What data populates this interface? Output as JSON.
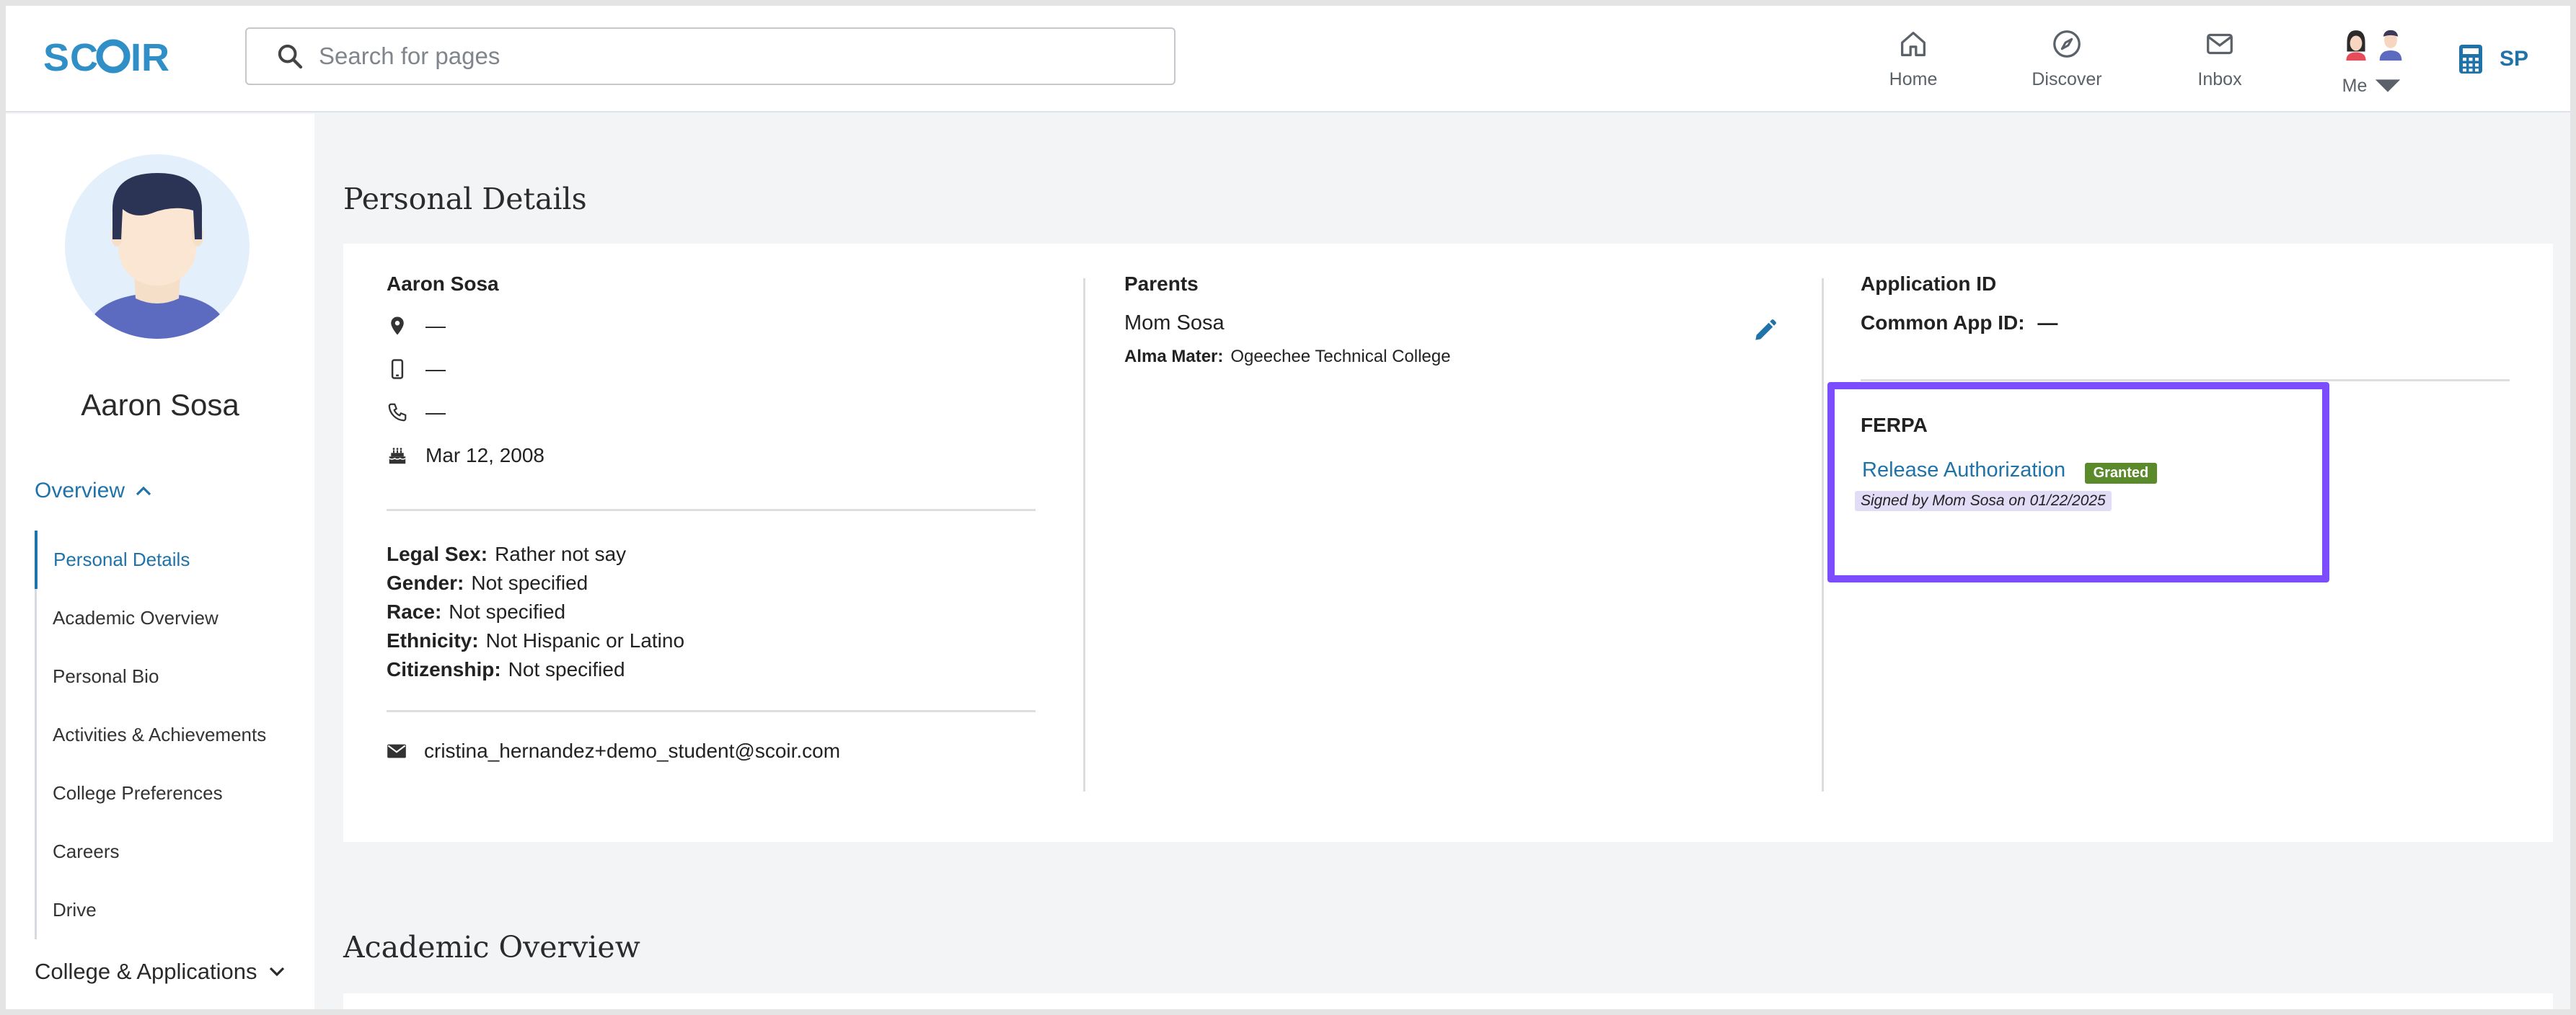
{
  "brand": {
    "logo_text": "SCOIR",
    "accent": "#1f73a8",
    "highlight": "#7c4dff"
  },
  "search": {
    "placeholder": "Search for pages",
    "value": ""
  },
  "nav": {
    "home": "Home",
    "discover": "Discover",
    "inbox": "Inbox",
    "me": "Me",
    "sp": "SP"
  },
  "sidebar": {
    "student_name": "Aaron Sosa",
    "overview": "Overview",
    "items": [
      {
        "label": "Personal Details",
        "active": true
      },
      {
        "label": "Academic Overview"
      },
      {
        "label": "Personal Bio"
      },
      {
        "label": "Activities & Achievements"
      },
      {
        "label": "College Preferences"
      },
      {
        "label": "Careers"
      },
      {
        "label": "Drive"
      }
    ],
    "college_apps": "College & Applications"
  },
  "personal_details": {
    "title": "Personal Details",
    "student": {
      "name": "Aaron Sosa",
      "address": "—",
      "mobile": "—",
      "phone": "—",
      "birthday": "Mar 12, 2008",
      "legal_sex_label": "Legal Sex:",
      "legal_sex": "Rather not say",
      "gender_label": "Gender:",
      "gender": "Not specified",
      "race_label": "Race:",
      "race": "Not specified",
      "ethnicity_label": "Ethnicity:",
      "ethnicity": "Not Hispanic or Latino",
      "citizenship_label": "Citizenship:",
      "citizenship": "Not specified",
      "email": "cristina_hernandez+demo_student@scoir.com"
    },
    "parents": {
      "heading": "Parents",
      "name": "Mom Sosa",
      "alma_mater_label": "Alma Mater:",
      "alma_mater": "Ogeechee Technical College"
    },
    "application": {
      "heading": "Application ID",
      "common_app_label": "Common App ID:",
      "common_app_value": "—"
    },
    "ferpa": {
      "heading": "FERPA",
      "link": "Release Authorization",
      "status": "Granted",
      "signed": "Signed by Mom Sosa on 01/22/2025"
    }
  },
  "academic_overview": {
    "title": "Academic Overview"
  }
}
